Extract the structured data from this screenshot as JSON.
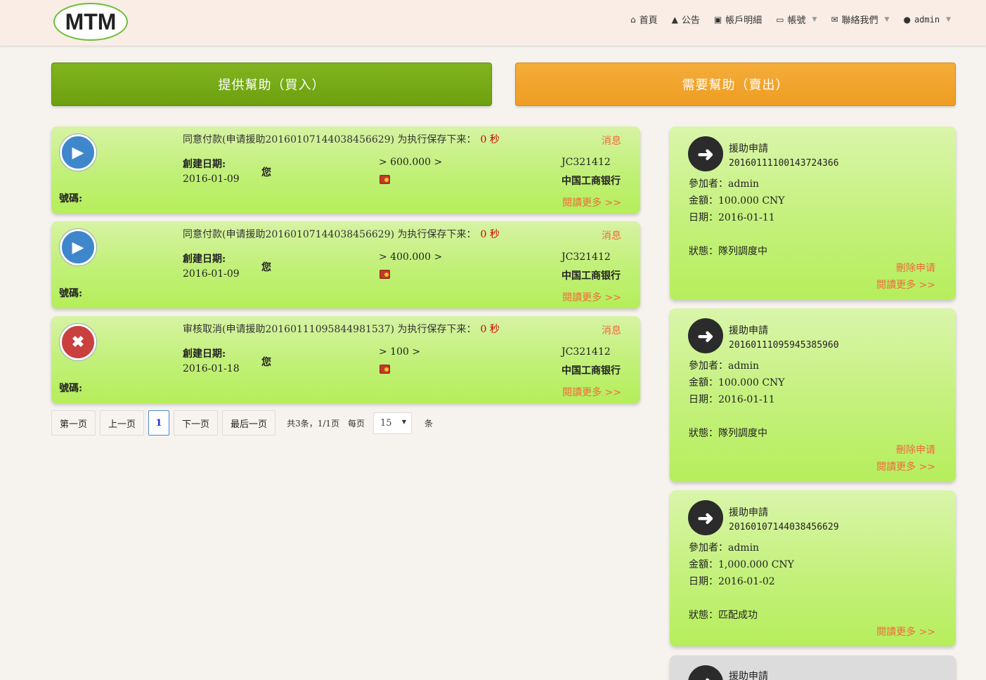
{
  "nav": {
    "logo": "MTM",
    "items": [
      {
        "icon": "home-icon",
        "glyph": "⌂",
        "label": "首頁"
      },
      {
        "icon": "bell-icon",
        "glyph": "▲",
        "label": "公告"
      },
      {
        "icon": "money-icon",
        "glyph": "▣",
        "label": "帳戶明細"
      },
      {
        "icon": "card-icon",
        "glyph": "▭",
        "label": "帳號"
      },
      {
        "icon": "envelope-icon",
        "glyph": "✉",
        "label": "聯絡我們"
      },
      {
        "icon": "user-icon",
        "glyph": "●",
        "label": "admin"
      }
    ]
  },
  "actions": {
    "buy_label": "提供幫助（買入）",
    "sell_label": "需要幫助（賣出）"
  },
  "orders": [
    {
      "status": "play",
      "title": "同意付款(申请援助20160107144038456629) 为执行保存下来：",
      "timer": "0 秒",
      "message_label": "消息",
      "created_label": "創建日期:",
      "created_date": "2016-01-09",
      "party": "您",
      "amount": "> 600.000 >",
      "code": "JC321412",
      "bank": "中国工商银行",
      "number_label": "號碼:",
      "read_more": "閱讀更多 >>"
    },
    {
      "status": "play",
      "title": "同意付款(申请援助20160107144038456629) 为执行保存下来：",
      "timer": "0 秒",
      "message_label": "消息",
      "created_label": "創建日期:",
      "created_date": "2016-01-09",
      "party": "您",
      "amount": "> 400.000 >",
      "code": "JC321412",
      "bank": "中国工商银行",
      "number_label": "號碼:",
      "read_more": "閱讀更多 >>"
    },
    {
      "status": "cancel",
      "title": "审核取消(申请援助20160111095844981537) 为执行保存下来：",
      "timer": "0 秒",
      "message_label": "消息",
      "created_label": "創建日期:",
      "created_date": "2016-01-18",
      "party": "您",
      "amount": "> 100 >",
      "code": "JC321412",
      "bank": "中国工商银行",
      "number_label": "號碼:",
      "read_more": "閱讀更多 >>"
    }
  ],
  "pagination": {
    "first": "第一页",
    "prev": "上一页",
    "current": "1",
    "next": "下一页",
    "last": "最后一页",
    "summary": "共3条，1/1页",
    "per_page_label": "每页",
    "per_page_value": "15",
    "unit": "条"
  },
  "requests": [
    {
      "title": "援助申請",
      "id": "20160111100143724366",
      "participant": "參加者：admin",
      "amount": "金額：100.000 CNY",
      "date": "日期：2016-01-11",
      "status": "狀態：隊列調度中",
      "delete_label": "刪除申请",
      "read_more": "閱讀更多 >>"
    },
    {
      "title": "援助申請",
      "id": "20160111095945385960",
      "participant": "參加者：admin",
      "amount": "金額：100.000 CNY",
      "date": "日期：2016-01-11",
      "status": "狀態：隊列調度中",
      "delete_label": "刪除申请",
      "read_more": "閱讀更多 >>"
    },
    {
      "title": "援助申請",
      "id": "20160107144038456629",
      "participant": "參加者：admin",
      "amount": "金額：1,000.000 CNY",
      "date": "日期：2016-01-02",
      "status": "狀態：匹配成功",
      "read_more": "閱讀更多 >>"
    },
    {
      "title": "援助申請"
    }
  ]
}
